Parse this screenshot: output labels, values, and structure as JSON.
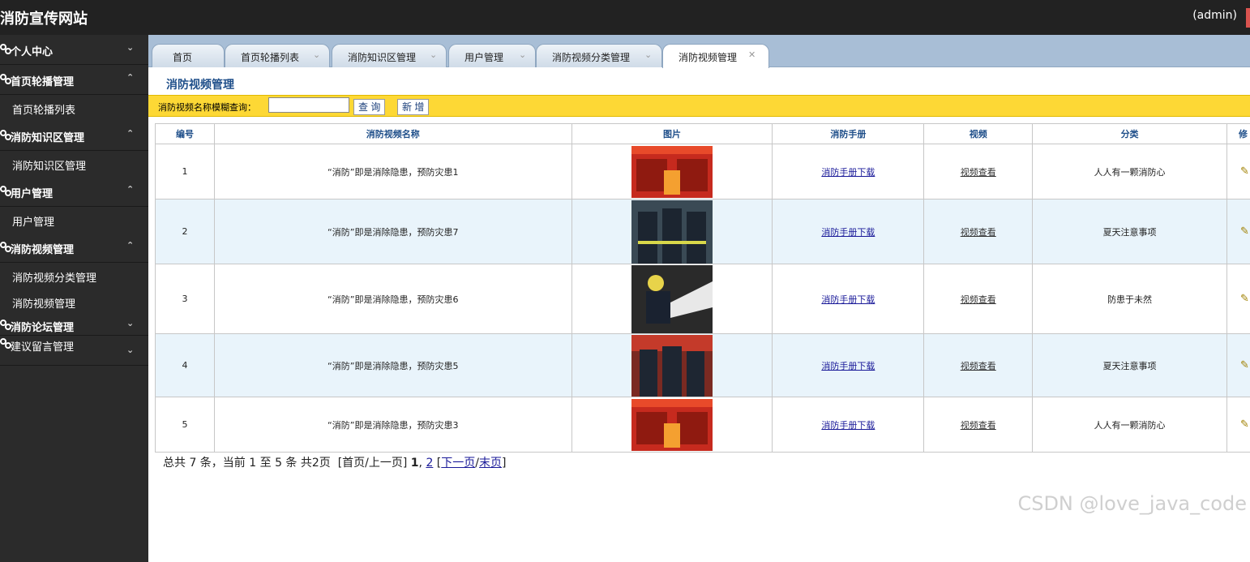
{
  "app": {
    "title": "消防宣传网站",
    "user": "(admin)"
  },
  "sidebar": {
    "groups": [
      {
        "label": "个人中心",
        "expanded": false,
        "items": []
      },
      {
        "label": "首页轮播管理",
        "expanded": true,
        "items": [
          "首页轮播列表"
        ]
      },
      {
        "label": "消防知识区管理",
        "expanded": true,
        "items": [
          "消防知识区管理"
        ]
      },
      {
        "label": "用户管理",
        "expanded": true,
        "items": [
          "用户管理"
        ]
      },
      {
        "label": "消防视频管理",
        "expanded": true,
        "items": [
          "消防视频分类管理",
          "消防视频管理"
        ]
      },
      {
        "label": "消防论坛管理",
        "expanded": false,
        "items": []
      },
      {
        "label": "建议留言管理",
        "expanded": false,
        "items": []
      }
    ]
  },
  "tabs": [
    {
      "label": "首页",
      "active": false
    },
    {
      "label": "首页轮播列表",
      "active": false
    },
    {
      "label": "消防知识区管理",
      "active": false
    },
    {
      "label": "用户管理",
      "active": false
    },
    {
      "label": "消防视频分类管理",
      "active": false
    },
    {
      "label": "消防视频管理",
      "active": true
    }
  ],
  "page": {
    "title": "消防视频管理",
    "search": {
      "label": "消防视频名称模糊查询：",
      "value": "",
      "query_btn": "查 询",
      "add_btn": "新 增"
    }
  },
  "table": {
    "headers": [
      "编号",
      "消防视频名称",
      "图片",
      "消防手册",
      "视频",
      "分类",
      "修"
    ],
    "rows": [
      {
        "id": "1",
        "name": "“消防”即是消除隐患，预防灾患1",
        "manual": "消防手册下载",
        "video": "视频查看",
        "category": "人人有一颗消防心",
        "image": "poster-red"
      },
      {
        "id": "2",
        "name": "“消防”即是消除隐患，预防灾患7",
        "manual": "消防手册下载",
        "video": "视频查看",
        "category": "夏天注意事项",
        "image": "firefighters-walking"
      },
      {
        "id": "3",
        "name": "“消防”即是消除隐患，预防灾患6",
        "manual": "消防手册下载",
        "video": "视频查看",
        "category": "防患于未然",
        "image": "firefighter-hose"
      },
      {
        "id": "4",
        "name": "“消防”即是消除隐患，预防灾患5",
        "manual": "消防手册下载",
        "video": "视频查看",
        "category": "夏天注意事项",
        "image": "firefighters-group"
      },
      {
        "id": "5",
        "name": "“消防”即是消除隐患，预防灾患3",
        "manual": "消防手册下载",
        "video": "视频查看",
        "category": "人人有一颗消防心",
        "image": "poster-red"
      }
    ]
  },
  "pager": {
    "summary": "总共 7 条，当前 1 至 5 条 共2页",
    "first_prev": "[首页/上一页]",
    "page1": "1",
    "page2": "2",
    "next": "下一页",
    "last": "末页"
  },
  "watermark": "CSDN @love_java_code",
  "colors": {
    "topbar": "#222222",
    "sidebar": "#2b2b2b",
    "search_bar": "#fdd835",
    "tabbar": "#a8bed6",
    "alt_row": "#e9f4fb"
  }
}
